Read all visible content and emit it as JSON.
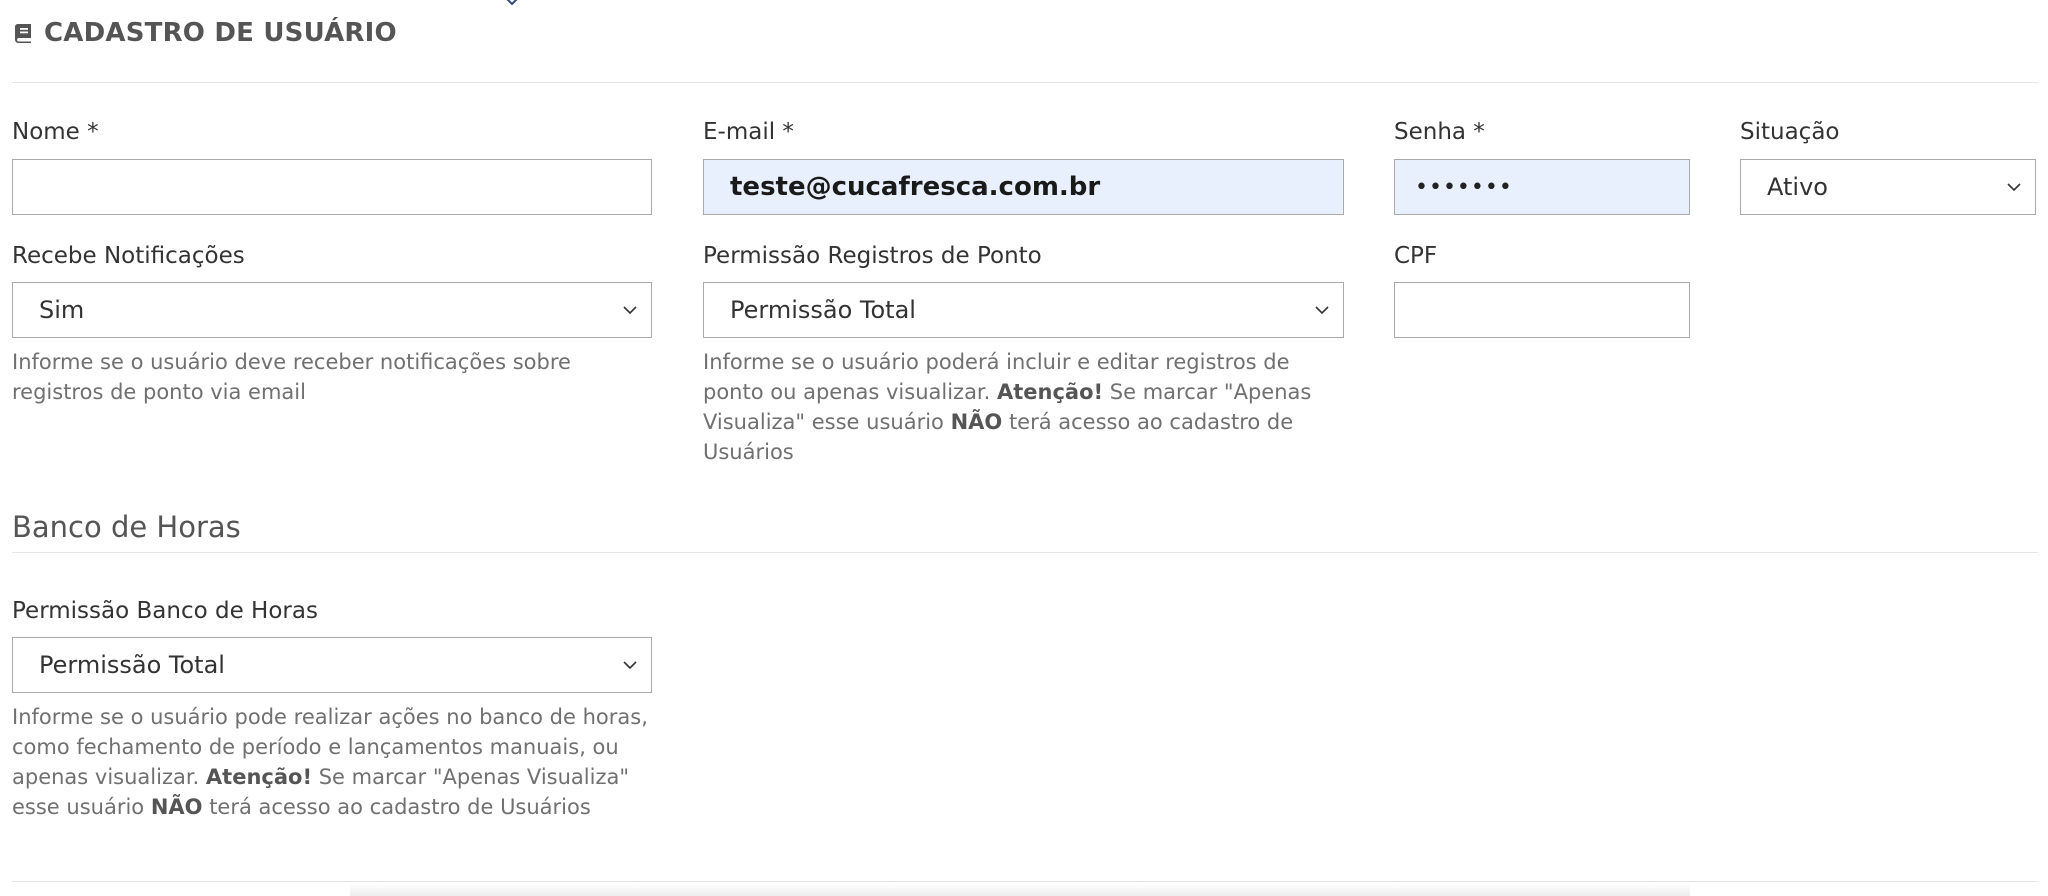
{
  "header": {
    "icon": "book-icon",
    "title": "CADASTRO DE USUÁRIO"
  },
  "form": {
    "nome": {
      "label": "Nome *",
      "value": ""
    },
    "email": {
      "label": "E-mail *",
      "value": "teste@cucafresca.com.br"
    },
    "senha": {
      "label": "Senha *",
      "value": "•••••••"
    },
    "situacao": {
      "label": "Situação",
      "value": "Ativo"
    },
    "recebe_notificacoes": {
      "label": "Recebe Notificações",
      "value": "Sim",
      "help": "Informe se o usuário deve receber notificações sobre registros de ponto via email"
    },
    "permissao_ponto": {
      "label": "Permissão Registros de Ponto",
      "value": "Permissão Total",
      "help_prefix": "Informe se o usuário poderá incluir e editar registros de ponto ou apenas visualizar. ",
      "help_strong1": "Atenção!",
      "help_middle": " Se marcar \"Apenas Visualiza\" esse usuário ",
      "help_strong2": "NÃO",
      "help_suffix": " terá acesso ao cadastro de Usuários"
    },
    "cpf": {
      "label": "CPF",
      "value": ""
    }
  },
  "banco_horas": {
    "section_title": "Banco de Horas",
    "permissao": {
      "label": "Permissão Banco de Horas",
      "value": "Permissão Total",
      "help_prefix": "Informe se o usuário pode realizar ações no banco de horas, como fechamento de período e lançamentos manuais, ou apenas visualizar. ",
      "help_strong1": "Atenção!",
      "help_middle": " Se marcar \"Apenas Visualiza\" esse usuário ",
      "help_strong2": "NÃO",
      "help_suffix": " terá acesso ao cadastro de Usuários"
    }
  },
  "colors": {
    "autofill_bg": "#e8f0fe",
    "border": "#aaaaaa",
    "help_text": "#707070"
  }
}
